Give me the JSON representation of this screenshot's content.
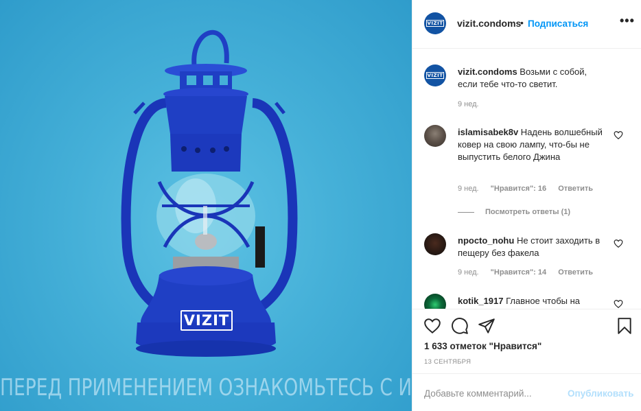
{
  "photo": {
    "logo_text": "VIZIT",
    "caption": "ПЕРЕД ПРИМЕНЕНИЕМ ОЗНАКОМЬТЕСЬ С ИНСТРУКЦИЕЙ",
    "background_color": "#45b0d8",
    "lantern_color": "#1f3fc4"
  },
  "header": {
    "avatar_text": "VIZIT",
    "username": "vizit.condoms",
    "separator": "•",
    "follow_label": "Подписаться",
    "more_icon": "ellipsis-icon",
    "more_label": "•••"
  },
  "caption_comment": {
    "username": "vizit.condoms",
    "text": " Возьми с собой, если тебе что-то светит.",
    "time": "9 нед."
  },
  "comments": [
    {
      "username": "islamisabek8v",
      "text": " Надень волшебный ковер на свою лампу, что-бы не выпустить белого Джина",
      "time": "9 нед.",
      "likes": "\"Нравится\": 16",
      "reply": "Ответить",
      "view_replies": "Посмотреть ответы (1)"
    },
    {
      "username": "npocto_nohu",
      "text": " Не стоит заходить в пещеру без факела",
      "time": "9 нед.",
      "likes": "\"Нравится\": 14",
      "reply": "Ответить"
    },
    {
      "username": "kotik_1917",
      "text": " Главное чтобы на"
    }
  ],
  "actions": {
    "like_icon": "heart-icon",
    "comment_icon": "comment-icon",
    "share_icon": "share-icon",
    "save_icon": "bookmark-icon"
  },
  "likes_count": "1 633 отметок \"Нравится\"",
  "post_date": "13 СЕНТЯБРЯ",
  "add_comment": {
    "placeholder": "Добавьте комментарий...",
    "publish_label": "Опубликовать"
  },
  "colors": {
    "accent": "#0095f6",
    "accent_disabled": "#b2dffc",
    "muted_text": "#8e8e8e",
    "brand": "#1253a3"
  }
}
